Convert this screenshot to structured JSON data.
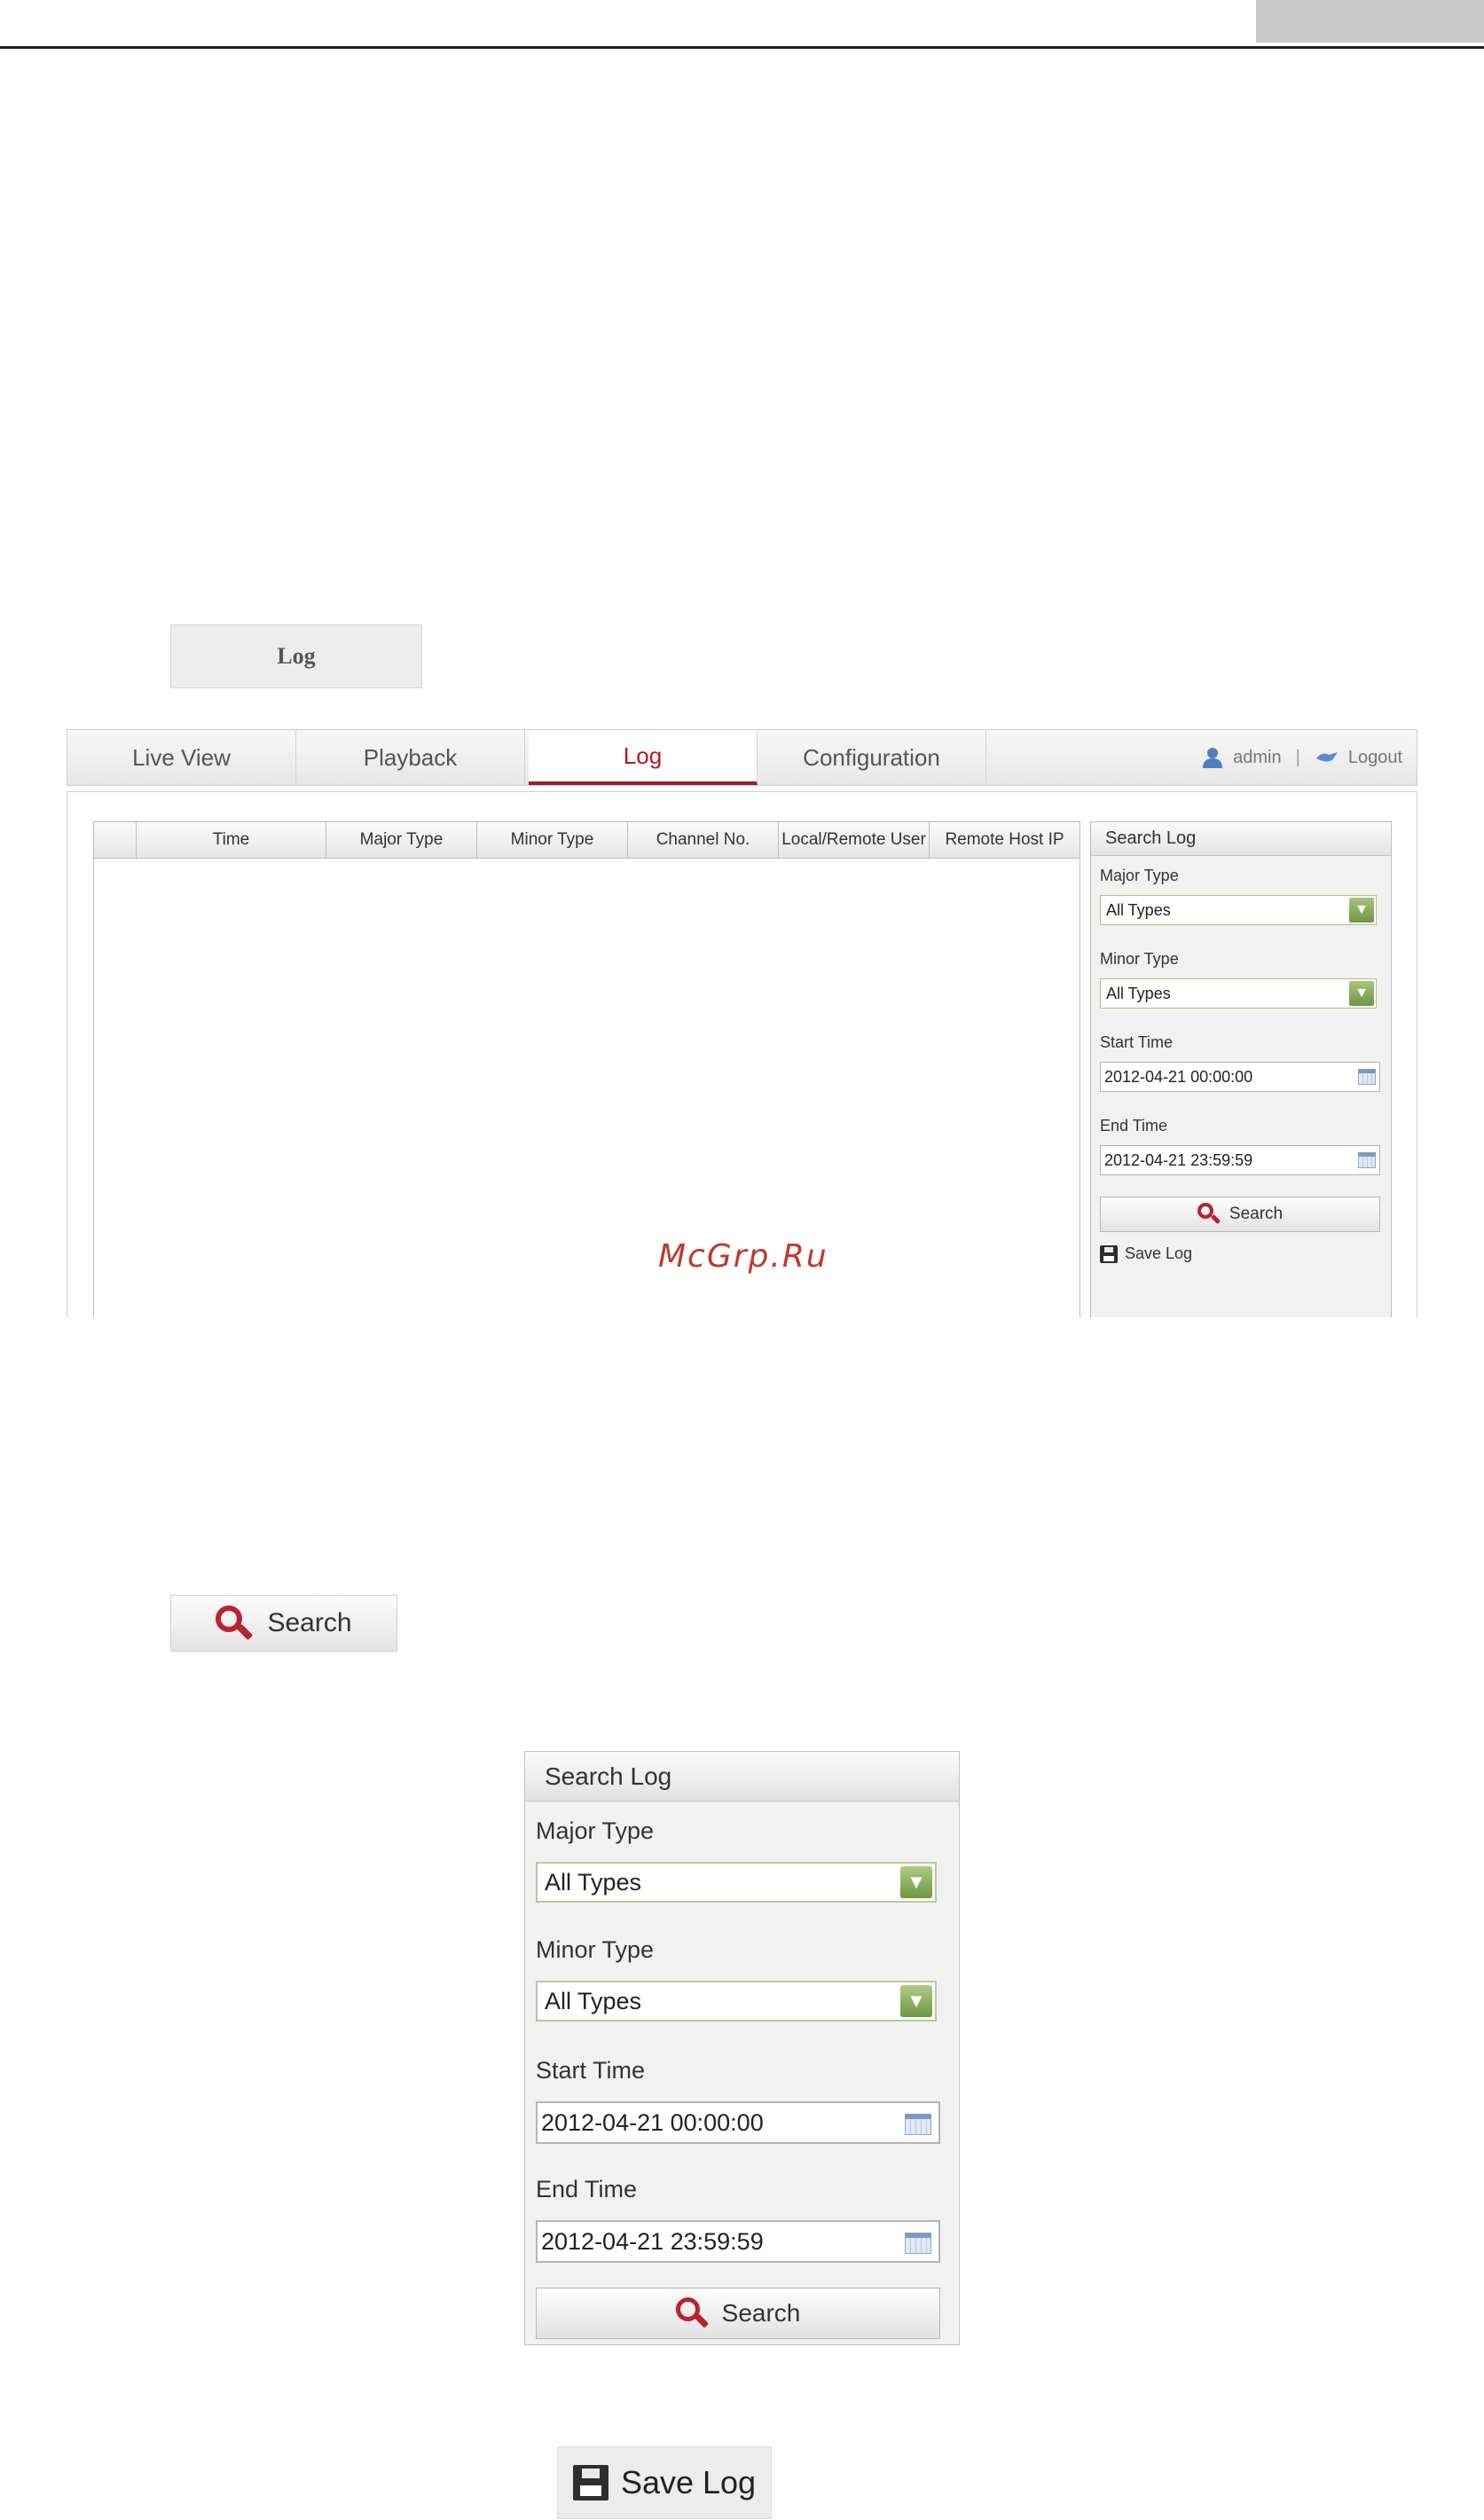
{
  "illustrations": {
    "log_button_label": "Log",
    "search_button_label": "Search",
    "save_log_label": "Save Log"
  },
  "nav": {
    "tabs": [
      {
        "label": "Live View"
      },
      {
        "label": "Playback"
      },
      {
        "label": "Log",
        "active": true
      },
      {
        "label": "Configuration"
      }
    ],
    "user": "admin",
    "separator": "|",
    "logout": "Logout"
  },
  "table": {
    "columns": [
      "",
      "Time",
      "Major Type",
      "Minor Type",
      "Channel No.",
      "Local/Remote User",
      "Remote Host IP"
    ]
  },
  "search_panel": {
    "title": "Search Log",
    "major_type_label": "Major Type",
    "major_type_value": "All Types",
    "minor_type_label": "Minor Type",
    "minor_type_value": "All Types",
    "start_time_label": "Start Time",
    "start_time_value": "2012-04-21 00:00:00",
    "end_time_label": "End Time",
    "end_time_value": "2012-04-21 23:59:59",
    "search_button": "Search",
    "save_log": "Save Log"
  },
  "watermark": "McGrp.Ru",
  "colors": {
    "accent": "#a11a2a",
    "search_icon": "#b8232f",
    "select_arrow": "#6f9744"
  },
  "icons": {
    "user": "user-icon",
    "logout": "logout-icon",
    "search": "magnifier-icon",
    "save": "floppy-disk-icon",
    "calendar": "calendar-icon",
    "dropdown": "chevron-down-icon"
  }
}
